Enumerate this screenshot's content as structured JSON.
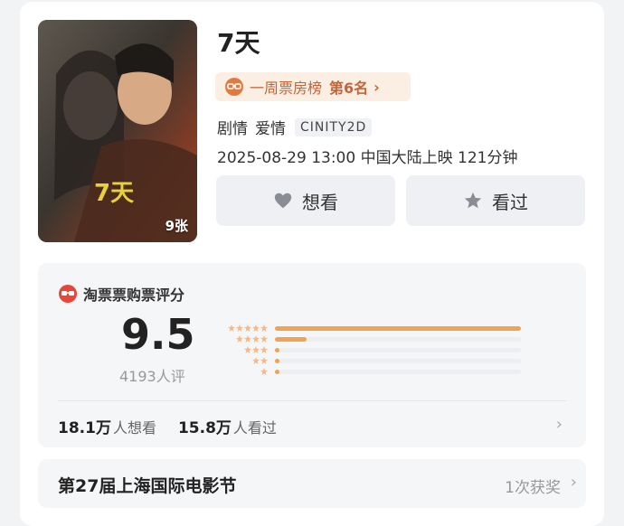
{
  "movie": {
    "title": "7天",
    "poster_title": "7天",
    "poster_count": "9张",
    "rank": {
      "prefix": "一周票房榜",
      "rank_text": "第6名",
      "chevron": "›"
    },
    "genres": [
      "剧情",
      "爱情"
    ],
    "format": "CINITY2D",
    "release": "2025-08-29 13:00 中国大陆上映 121分钟"
  },
  "actions": {
    "want_label": "想看",
    "seen_label": "看过"
  },
  "rating": {
    "source": "淘票票购票评分",
    "score": "9.5",
    "votes": "4193人评",
    "distribution": [
      {
        "stars": 5,
        "fraction": 1.0
      },
      {
        "stars": 4,
        "fraction": 0.13
      },
      {
        "stars": 3,
        "fraction": 0.02
      },
      {
        "stars": 2,
        "fraction": 0.02
      },
      {
        "stars": 1,
        "fraction": 0.02
      }
    ],
    "want_count": "18.1万",
    "want_suffix": "人想看",
    "seen_count": "15.8万",
    "seen_suffix": "人看过"
  },
  "festival": {
    "title": "第27届上海国际电影节",
    "awards": "1次获奖"
  },
  "colors": {
    "accent": "#c5643a",
    "bar_fill": "#f0a354",
    "bar_track": "#eceef2",
    "pill_bg": "#fbeee3"
  }
}
